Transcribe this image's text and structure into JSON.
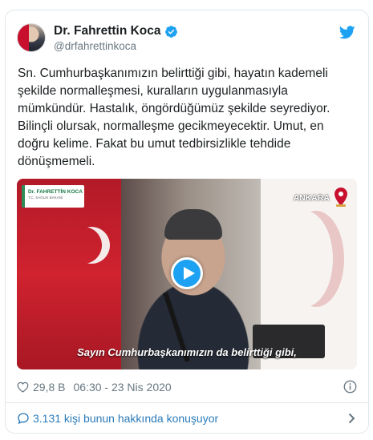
{
  "author": {
    "display_name": "Dr. Fahrettin Koca",
    "handle": "@drfahrettinkoca",
    "verified": true
  },
  "tweet": {
    "text": "Sn. Cumhurbaşkanımızın belirttiği gibi, hayatın kademeli şekilde normalleşmesi, kuralların uygulanmasıyla mümkündür. Hastalık, öngördüğümüz şekilde seyrediyor. Bilinçli olursak, normalleşme gecikmeyecektir. Umut, en doğru kelime. Fakat bu umut tedbirsizlikle tehdide dönüşmemeli."
  },
  "video": {
    "lower_third_name": "Dr. FAHRETTİN KOCA",
    "lower_third_title": "T.C. SAĞLIK BAKANI",
    "location": "ANKARA",
    "caption": "Sayın Cumhurbaşkanımızın da belirttiği gibi,"
  },
  "meta": {
    "like_count": "29,8 B",
    "timestamp": "06:30 - 23 Nis 2020"
  },
  "conversation": {
    "label": "3.131 kişi bunun hakkında konuşuyor"
  },
  "colors": {
    "twitter_blue": "#1da1f2",
    "link_blue": "#2b7bb9",
    "muted_text": "#697882",
    "border": "#e1e8ed"
  },
  "icons": [
    "twitter-bird-icon",
    "verified-badge-icon",
    "play-icon",
    "location-pin-icon",
    "heart-icon",
    "info-icon",
    "comment-icon",
    "chevron-right-icon"
  ]
}
